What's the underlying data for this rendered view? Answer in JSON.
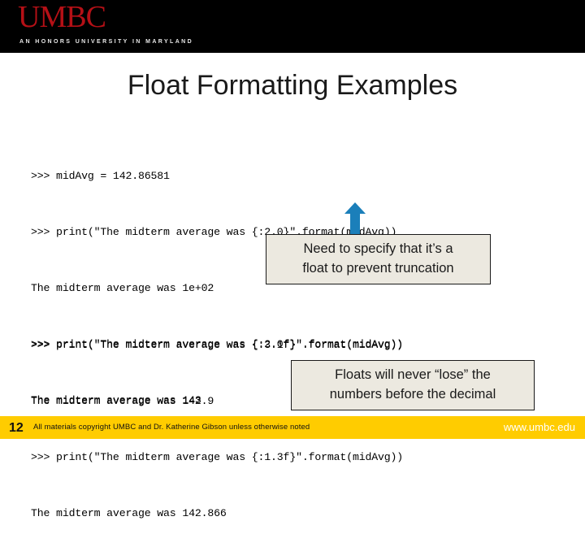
{
  "header": {
    "wordmark": "UMBC",
    "tagline": "AN HONORS UNIVERSITY IN MARYLAND",
    "band_color": "#000000",
    "wordmark_color": "#b51016"
  },
  "title": "Float Formatting Examples",
  "code_block_1": [
    ">>> midAvg = 142.86581",
    ">>> print(\"The midterm average was {:2.0}\".format(midAvg))",
    "The midterm average was 1e+02",
    ">>> print(\"The midterm average was {:2.0f}\".format(midAvg))",
    "The midterm average was 143"
  ],
  "code_block_2": [
    ">>> print(\"The midterm average was {:3.1f}\".format(midAvg))",
    "The midterm average was 142.9",
    ">>> print(\"The midterm average was {:1.3f}\".format(midAvg))",
    "The midterm average was 142.866"
  ],
  "arrow": {
    "icon": "arrow-up-icon",
    "color": "#1b7fba",
    "points_to": "{:2.0f}"
  },
  "callouts": [
    {
      "lines": [
        "Need to specify that it’s a",
        "float to prevent truncation"
      ],
      "background": "#ece9e0",
      "border": "#1a1a1a"
    },
    {
      "lines": [
        "Floats will never “lose” the",
        "numbers before the decimal"
      ],
      "background": "#ece9e0",
      "border": "#1a1a1a"
    }
  ],
  "footer": {
    "page_number": "12",
    "copyright": "All materials copyright UMBC and Dr. Katherine Gibson unless otherwise noted",
    "url": "www.umbc.edu",
    "band_color": "#ffcc00"
  }
}
